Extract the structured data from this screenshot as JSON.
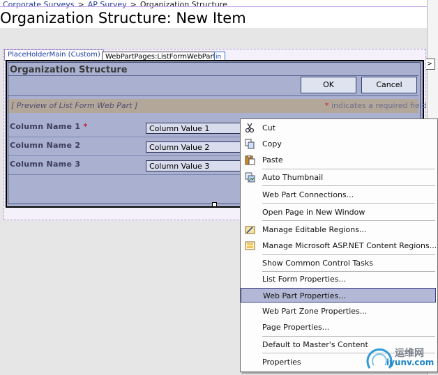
{
  "breadcrumb": {
    "items": [
      "Corporate Surveys",
      "AP Survey",
      "Organization Structure"
    ],
    "separator": ">"
  },
  "page": {
    "title": "Organization Structure: New Item"
  },
  "tabs": {
    "placeholder_main": "PlaceHolderMain (Custom)",
    "listform_webpart": "WebPartPages:ListFormWebPart",
    "small_tab": "in"
  },
  "expand_button": ">",
  "webpart": {
    "title": "Organization Structure",
    "ok_label": "OK",
    "cancel_label": "Cancel",
    "preview_text": "[ Preview of List Form Web Part ]",
    "required_star": "*",
    "required_note": "indicates a required field",
    "rows": [
      {
        "label": "Column Name 1",
        "required": "*",
        "value": "Column Value 1"
      },
      {
        "label": "Column Name 2",
        "required": "",
        "value": "Column Value 2"
      },
      {
        "label": "Column Name 3",
        "required": "",
        "value": "Column Value 3"
      }
    ]
  },
  "context_menu": {
    "items": [
      {
        "label": "Cut",
        "icon": "scissors-icon"
      },
      {
        "label": "Copy",
        "icon": "copy-icon"
      },
      {
        "label": "Paste",
        "icon": "paste-icon"
      },
      {
        "label": "Auto Thumbnail",
        "icon": "thumbnail-icon"
      },
      {
        "label": "Web Part Connections...",
        "icon": ""
      },
      {
        "label": "Open Page in New Window",
        "icon": ""
      },
      {
        "label": "Manage Editable Regions...",
        "icon": "editable-regions-icon"
      },
      {
        "label": "Manage Microsoft ASP.NET Content Regions...",
        "icon": "content-regions-icon"
      },
      {
        "label": "Show Common Control Tasks",
        "icon": ""
      },
      {
        "label": "List Form Properties...",
        "icon": ""
      },
      {
        "label": "Web Part Properties...",
        "icon": "",
        "highlighted": true
      },
      {
        "label": "Web Part Zone Properties...",
        "icon": ""
      },
      {
        "label": "Page Properties...",
        "icon": ""
      },
      {
        "label": "Default to Master's Content",
        "icon": ""
      },
      {
        "label": "Properties",
        "icon": ""
      }
    ]
  },
  "watermark": {
    "line1": "运维网",
    "line2": "iyunv.com"
  },
  "colors": {
    "webpart_bg": "#a9b0d0",
    "preview_bar": "#b3a79a",
    "menu_highlight": "#b2b8d6",
    "required_star": "#d01020"
  }
}
